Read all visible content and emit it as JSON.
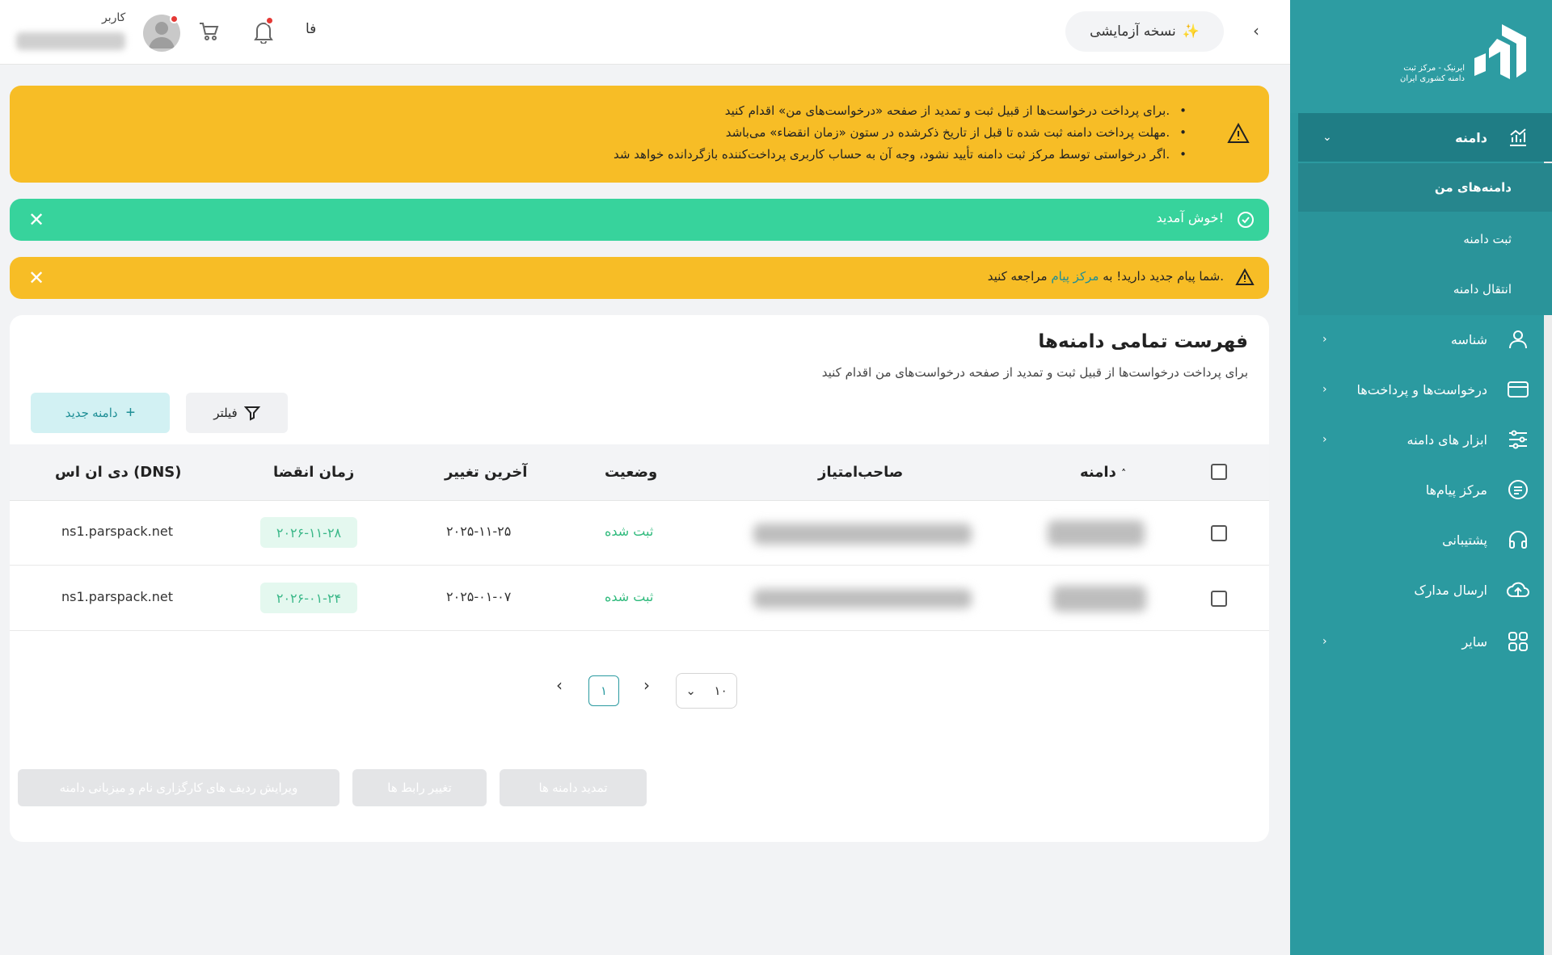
{
  "sidebar": {
    "logo_text_line1": "ایرنیک - مرکز ثبت",
    "logo_text_line2": "دامنه کشوری ایران",
    "items": [
      {
        "label": "دامنه",
        "icon": "chart-icon"
      },
      {
        "label": "شناسه",
        "icon": "user-icon"
      },
      {
        "label": "درخواست‌ها و پرداخت‌ها",
        "icon": "card-icon"
      },
      {
        "label": "ابزار های دامنه",
        "icon": "sliders-icon"
      },
      {
        "label": "مرکز پیام‌ها",
        "icon": "message-icon"
      },
      {
        "label": "پشتیبانی",
        "icon": "headset-icon"
      },
      {
        "label": "ارسال مدارک",
        "icon": "cloud-upload-icon"
      },
      {
        "label": "سایر",
        "icon": "grid-icon"
      }
    ],
    "sub_items": [
      "دامنه‌های من",
      "ثبت دامنه",
      "انتقال دامنه"
    ]
  },
  "header": {
    "trial_label": "نسخه آزمایشی",
    "lang": "فا",
    "user_role": "کاربر"
  },
  "alerts": {
    "info_lines": [
      "برای پرداخت درخواست‌ها از قبیل ثبت و تمدید از صفحه «درخواست‌های من» اقدام کنید.",
      "مهلت پرداخت دامنه ثبت شده تا قبل از تاریخ ذکرشده در ستون «زمان انقضاء» می‌باشد.",
      "اگر درخواستی توسط مرکز ثبت دامنه تأیید نشود، وجه آن به حساب کاربری پرداخت‌کننده بازگردانده خواهد شد."
    ],
    "welcome": "خوش آمدید!",
    "new_message_prefix": "شما پیام جدید دارید! به",
    "new_message_link": "مرکز پیام",
    "new_message_suffix": "مراجعه کنید."
  },
  "main": {
    "title": "فهرست تمامی دامنه‌ها",
    "subtitle": "برای پرداخت درخواست‌ها از قبیل ثبت و تمدید از صفحه درخواست‌های من اقدام کنید",
    "filter_label": "فیلتر",
    "new_domain_label": "دامنه جدید",
    "columns": [
      "دامنه",
      "صاحب‌امتیاز",
      "وضعیت",
      "آخرین تغییر",
      "زمان انقضا",
      "دی ان اس (DNS)"
    ],
    "rows": [
      {
        "status": "ثبت شده",
        "last_change": "۲۰۲۵-۱۱-۲۵",
        "expire": "۲۰۲۶-۱۱-۲۸",
        "dns": "ns1.parspack.net"
      },
      {
        "status": "ثبت شده",
        "last_change": "۲۰۲۵-۰۱-۰۷",
        "expire": "۲۰۲۶-۰۱-۲۴",
        "dns": "ns1.parspack.net"
      }
    ],
    "pagination": {
      "current_page": "۱",
      "page_size": "۱۰"
    },
    "actions": {
      "renew": "تمدید دامنه ها",
      "change_contact": "تغییر رابط ها",
      "edit_ns": "ویرایش ردیف های کارگزاری نام و میزبانی دامنه"
    }
  },
  "colors": {
    "sidebar": "#2b9aa0",
    "warning": "#f7bd26",
    "success": "#37d39c",
    "accent": "#1f8f96"
  }
}
